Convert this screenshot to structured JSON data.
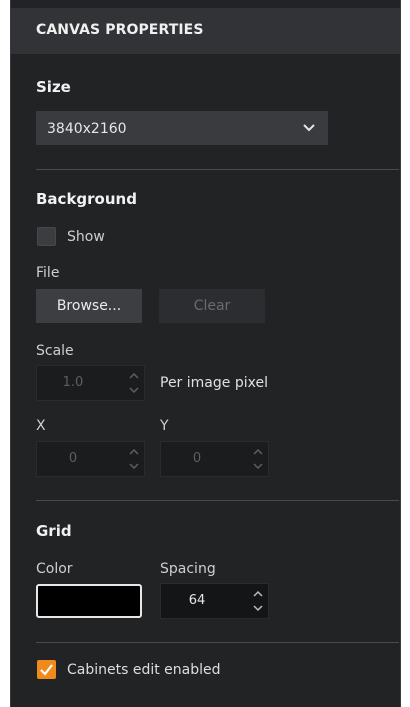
{
  "panel": {
    "title": "CANVAS PROPERTIES"
  },
  "size": {
    "title": "Size",
    "selected": "3840x2160",
    "icon": "chevron-down-icon"
  },
  "background": {
    "title": "Background",
    "show_label": "Show",
    "show_checked": false,
    "file_label": "File",
    "browse_label": "Browse...",
    "clear_label": "Clear",
    "scale_label": "Scale",
    "scale_value": "1.0",
    "scale_unit": "Per image pixel",
    "x_label": "X",
    "x_value": "0",
    "y_label": "Y",
    "y_value": "0"
  },
  "grid": {
    "title": "Grid",
    "color_label": "Color",
    "color_value": "#000000",
    "spacing_label": "Spacing",
    "spacing_value": "64"
  },
  "cabinets": {
    "label": "Cabinets edit enabled",
    "checked": true,
    "accent": "#f08a1c"
  }
}
